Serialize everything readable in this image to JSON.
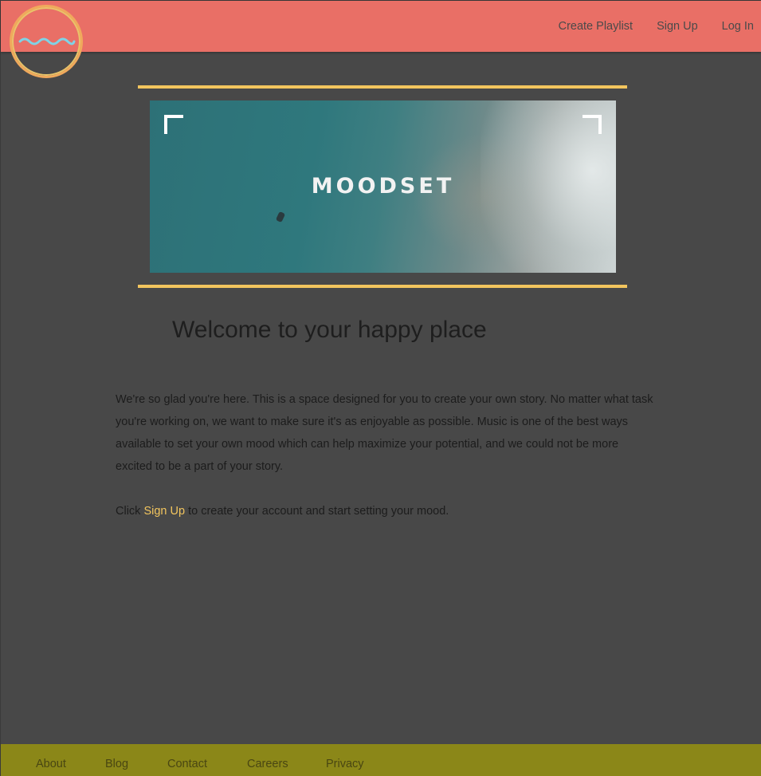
{
  "header": {
    "nav": {
      "create_playlist": "Create Playlist",
      "sign_up": "Sign Up",
      "log_in": "Log In"
    },
    "logo_icon": "wave-circle-logo"
  },
  "banner": {
    "brand": "MOODSET"
  },
  "main": {
    "heading": "Welcome to your happy place",
    "intro": "We're so glad you're here. This is a space designed for you to create your own story. No matter what task you're working on, we want to make sure it's as enjoyable as possible. Music is one of the best ways available to set your own mood which can help maximize your potential, and we could not be more excited to be a part of your story.",
    "cta_prefix": "Click ",
    "cta_link": "Sign Up",
    "cta_suffix": " to create your account and start setting your mood."
  },
  "footer": {
    "about": "About",
    "blog": "Blog",
    "contact": "Contact",
    "careers": "Careers",
    "privacy": "Privacy"
  },
  "colors": {
    "header_bg": "#e96f66",
    "page_bg": "#484848",
    "accent_gold": "#f2c55e",
    "footer_bg": "#8b8718",
    "wave_blue": "#7fd3e6"
  }
}
